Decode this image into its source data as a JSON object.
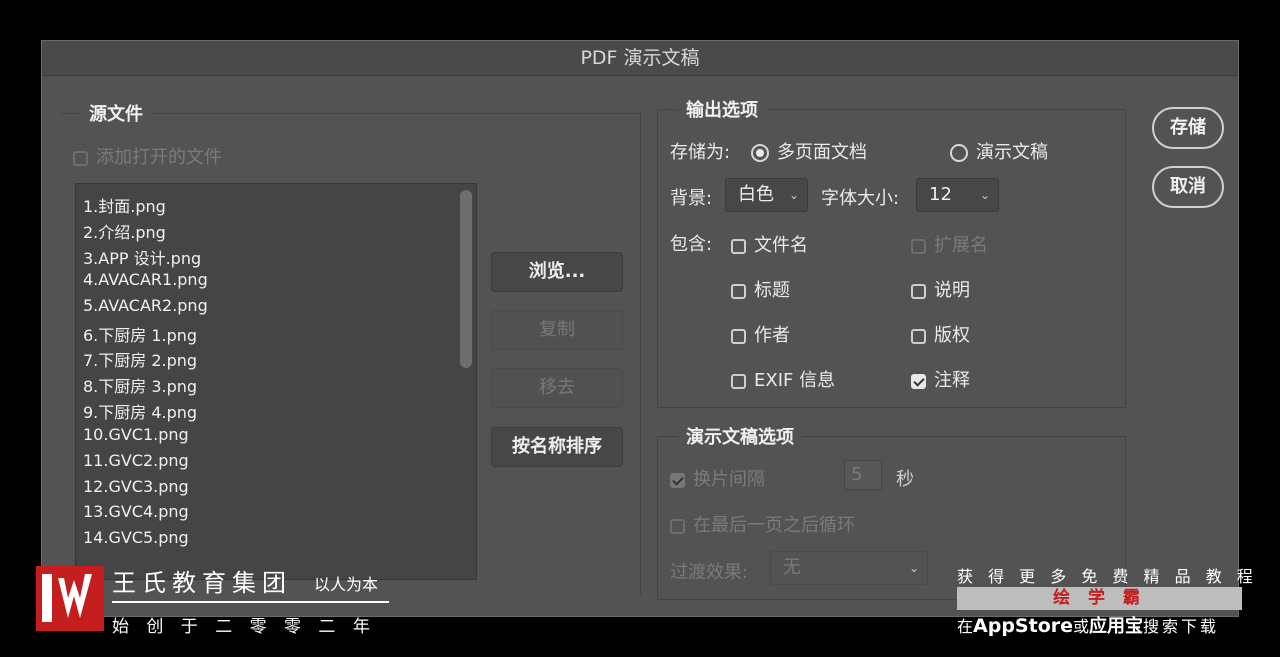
{
  "window": {
    "title": "PDF 演示文稿"
  },
  "source": {
    "group_title": "源文件",
    "add_open_files": "添加打开的文件",
    "files": [
      "1.封面.png",
      "2.介绍.png",
      "3.APP 设计.png",
      "4.AVACAR1.png",
      "5.AVACAR2.png",
      "6.下厨房 1.png",
      "7.下厨房 2.png",
      "8.下厨房 3.png",
      "9.下厨房 4.png",
      "10.GVC1.png",
      "11.GVC2.png",
      "12.GVC3.png",
      "13.GVC4.png",
      "14.GVC5.png"
    ]
  },
  "buttons": {
    "browse": "浏览...",
    "duplicate": "复制",
    "remove": "移去",
    "sort_by_name": "按名称排序",
    "save": "存储",
    "cancel": "取消"
  },
  "output": {
    "group_title": "输出选项",
    "save_as_label": "存储为:",
    "radio_multipage": "多页面文档",
    "radio_presentation": "演示文稿",
    "background_label": "背景:",
    "background_value": "白色",
    "font_size_label": "字体大小:",
    "font_size_value": "12",
    "include_label": "包含:",
    "filename": "文件名",
    "extension": "扩展名",
    "title": "标题",
    "description": "说明",
    "author": "作者",
    "copyright": "版权",
    "exif": "EXIF 信息",
    "annotations": "注释"
  },
  "presentation": {
    "group_title": "演示文稿选项",
    "advance_every": "换片间隔",
    "seconds_value": "5",
    "seconds_unit": "秒",
    "loop_after_last": "在最后一页之后循环",
    "transition_label": "过渡效果:",
    "transition_value": "无"
  },
  "watermark": {
    "brand": "王氏教育集团",
    "slogan": "以人为本",
    "founded": "始 创 于 二 零 零 二 年",
    "promo_top": "获 得 更 多 免 费 精 品 教 程",
    "promo_app": "绘 学 霸",
    "promo_bottom_1": "在",
    "promo_bottom_2": "AppStore",
    "promo_bottom_3": "或",
    "promo_bottom_4": "应用宝",
    "promo_bottom_5": "搜索下载"
  },
  "colors": {
    "dialog_bg": "#535353",
    "logo_red": "#c41e1e"
  }
}
